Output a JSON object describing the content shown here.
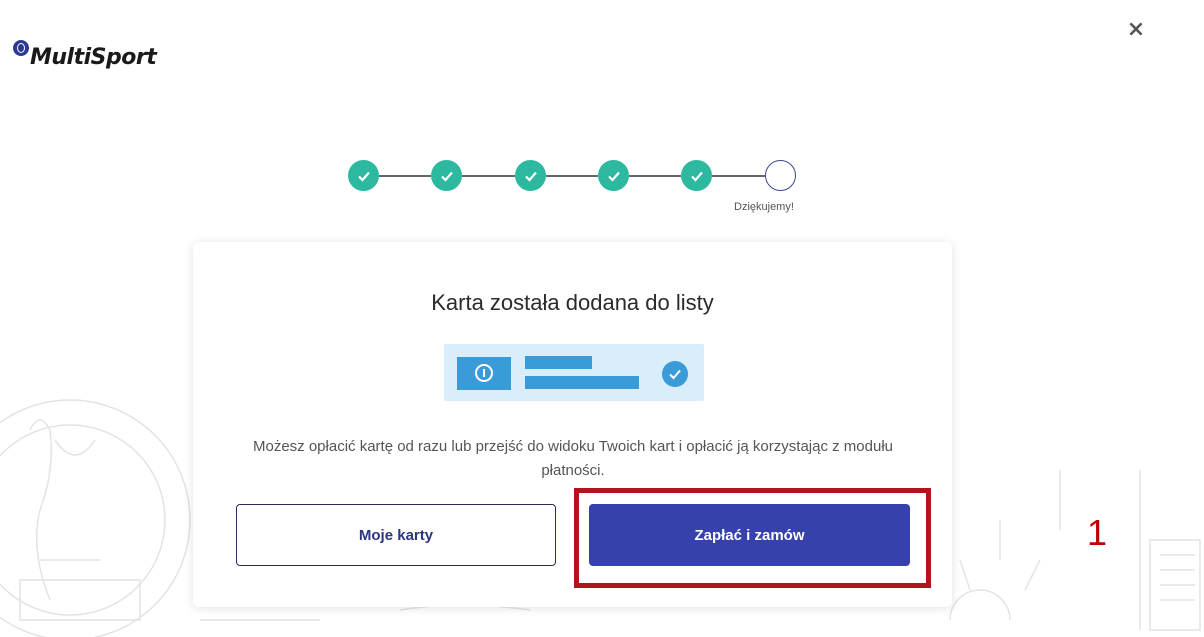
{
  "app": {
    "brand": "MultiSport",
    "close_symbol": "×"
  },
  "stepper": {
    "steps": [
      {
        "state": "done"
      },
      {
        "state": "done"
      },
      {
        "state": "done"
      },
      {
        "state": "done"
      },
      {
        "state": "done"
      },
      {
        "state": "pending",
        "label": "Dziękujemy!"
      }
    ]
  },
  "dialog": {
    "title": "Karta została dodana do listy",
    "description": "Możesz opłacić kartę od razu lub przejść do widoku Twoich kart i opłacić ją korzystając z modułu płatności.",
    "secondary_button": "Moje karty",
    "primary_button": "Zapłać i zamów"
  },
  "annotation": {
    "number": "1"
  },
  "colors": {
    "step_done": "#2db8a0",
    "primary": "#3641ab",
    "illustration_accent": "#3a9bd8",
    "highlight": "#b0151c"
  }
}
